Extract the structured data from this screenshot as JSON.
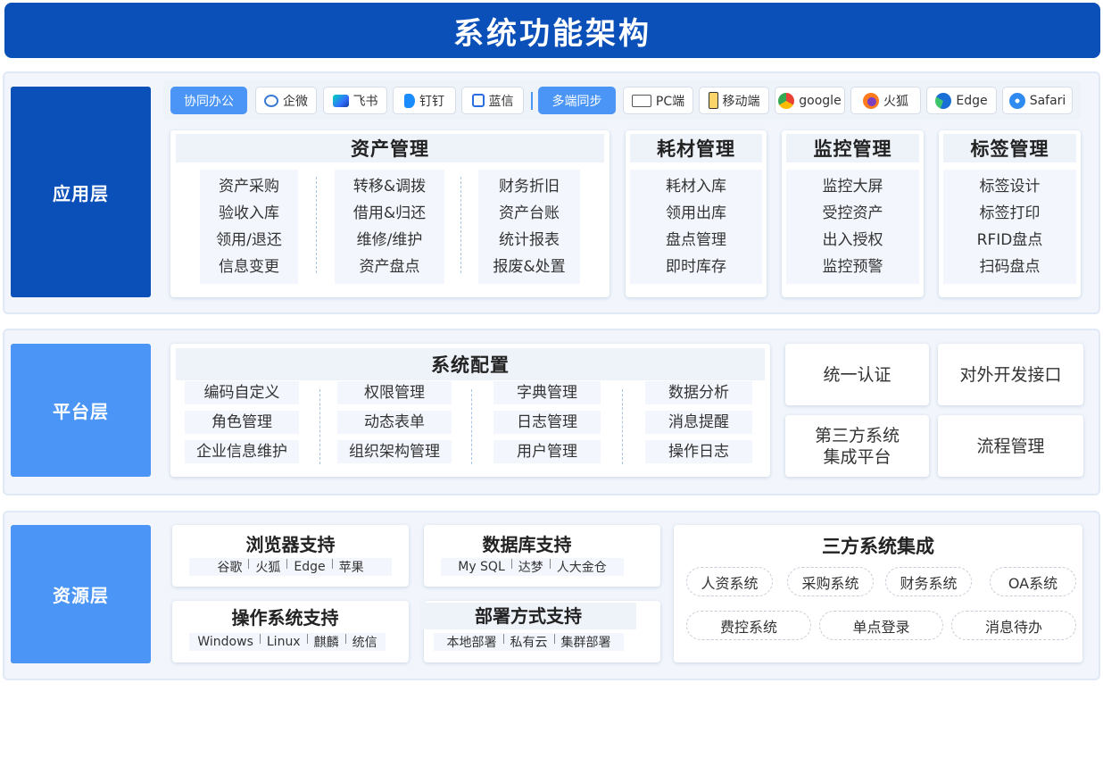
{
  "title": "系统功能架构",
  "layers": {
    "app": "应用层",
    "platform": "平台层",
    "resource": "资源层"
  },
  "strip": {
    "collab": "协同办公",
    "collab_items": [
      "企微",
      "飞书",
      "钉钉",
      "蓝信"
    ],
    "sync": "多端同步",
    "sync_items": [
      "PC端",
      "移动端",
      "google",
      "火狐",
      "Edge",
      "Safari"
    ]
  },
  "asset": {
    "title": "资产管理",
    "col1": [
      "资产采购",
      "验收入库",
      "领用/退还",
      "信息变更"
    ],
    "col2": [
      "转移&调拨",
      "借用&归还",
      "维修/维护",
      "资产盘点"
    ],
    "col3": [
      "财务折旧",
      "资产台账",
      "统计报表",
      "报废&处置"
    ]
  },
  "consumable": {
    "title": "耗材管理",
    "items": [
      "耗材入库",
      "领用出库",
      "盘点管理",
      "即时库存"
    ]
  },
  "monitor": {
    "title": "监控管理",
    "items": [
      "监控大屏",
      "受控资产",
      "出入授权",
      "监控预警"
    ]
  },
  "label": {
    "title": "标签管理",
    "items": [
      "标签设计",
      "标签打印",
      "RFID盘点",
      "扫码盘点"
    ]
  },
  "config": {
    "title": "系统配置",
    "col1": [
      "编码自定义",
      "角色管理",
      "企业信息维护"
    ],
    "col2": [
      "权限管理",
      "动态表单",
      "组织架构管理"
    ],
    "col3": [
      "字典管理",
      "日志管理",
      "用户管理"
    ],
    "col4": [
      "数据分析",
      "消息提醒",
      "操作日志"
    ]
  },
  "platform_cards": {
    "auth": "统一认证",
    "api": "对外开发接口",
    "third1": "第三方系统",
    "third2": "集成平台",
    "flow": "流程管理"
  },
  "browser": {
    "title": "浏览器支持",
    "items": [
      "谷歌",
      "火狐",
      "Edge",
      "苹果"
    ]
  },
  "database": {
    "title": "数据库支持",
    "items": [
      "My SQL",
      "达梦",
      "人大金仓"
    ]
  },
  "os": {
    "title": "操作系统支持",
    "items": [
      "Windows",
      "Linux",
      "麒麟",
      "统信"
    ]
  },
  "deploy": {
    "title": "部署方式支持",
    "items": [
      "本地部署",
      "私有云",
      "集群部署"
    ]
  },
  "integration": {
    "title": "三方系统集成",
    "row1": [
      "人资系统",
      "采购系统",
      "财务系统",
      "OA系统"
    ],
    "row2": [
      "费控系统",
      "单点登录",
      "消息待办"
    ]
  },
  "colors": {
    "dark_blue": "#0b4fb8",
    "light_blue": "#4a95f5"
  }
}
